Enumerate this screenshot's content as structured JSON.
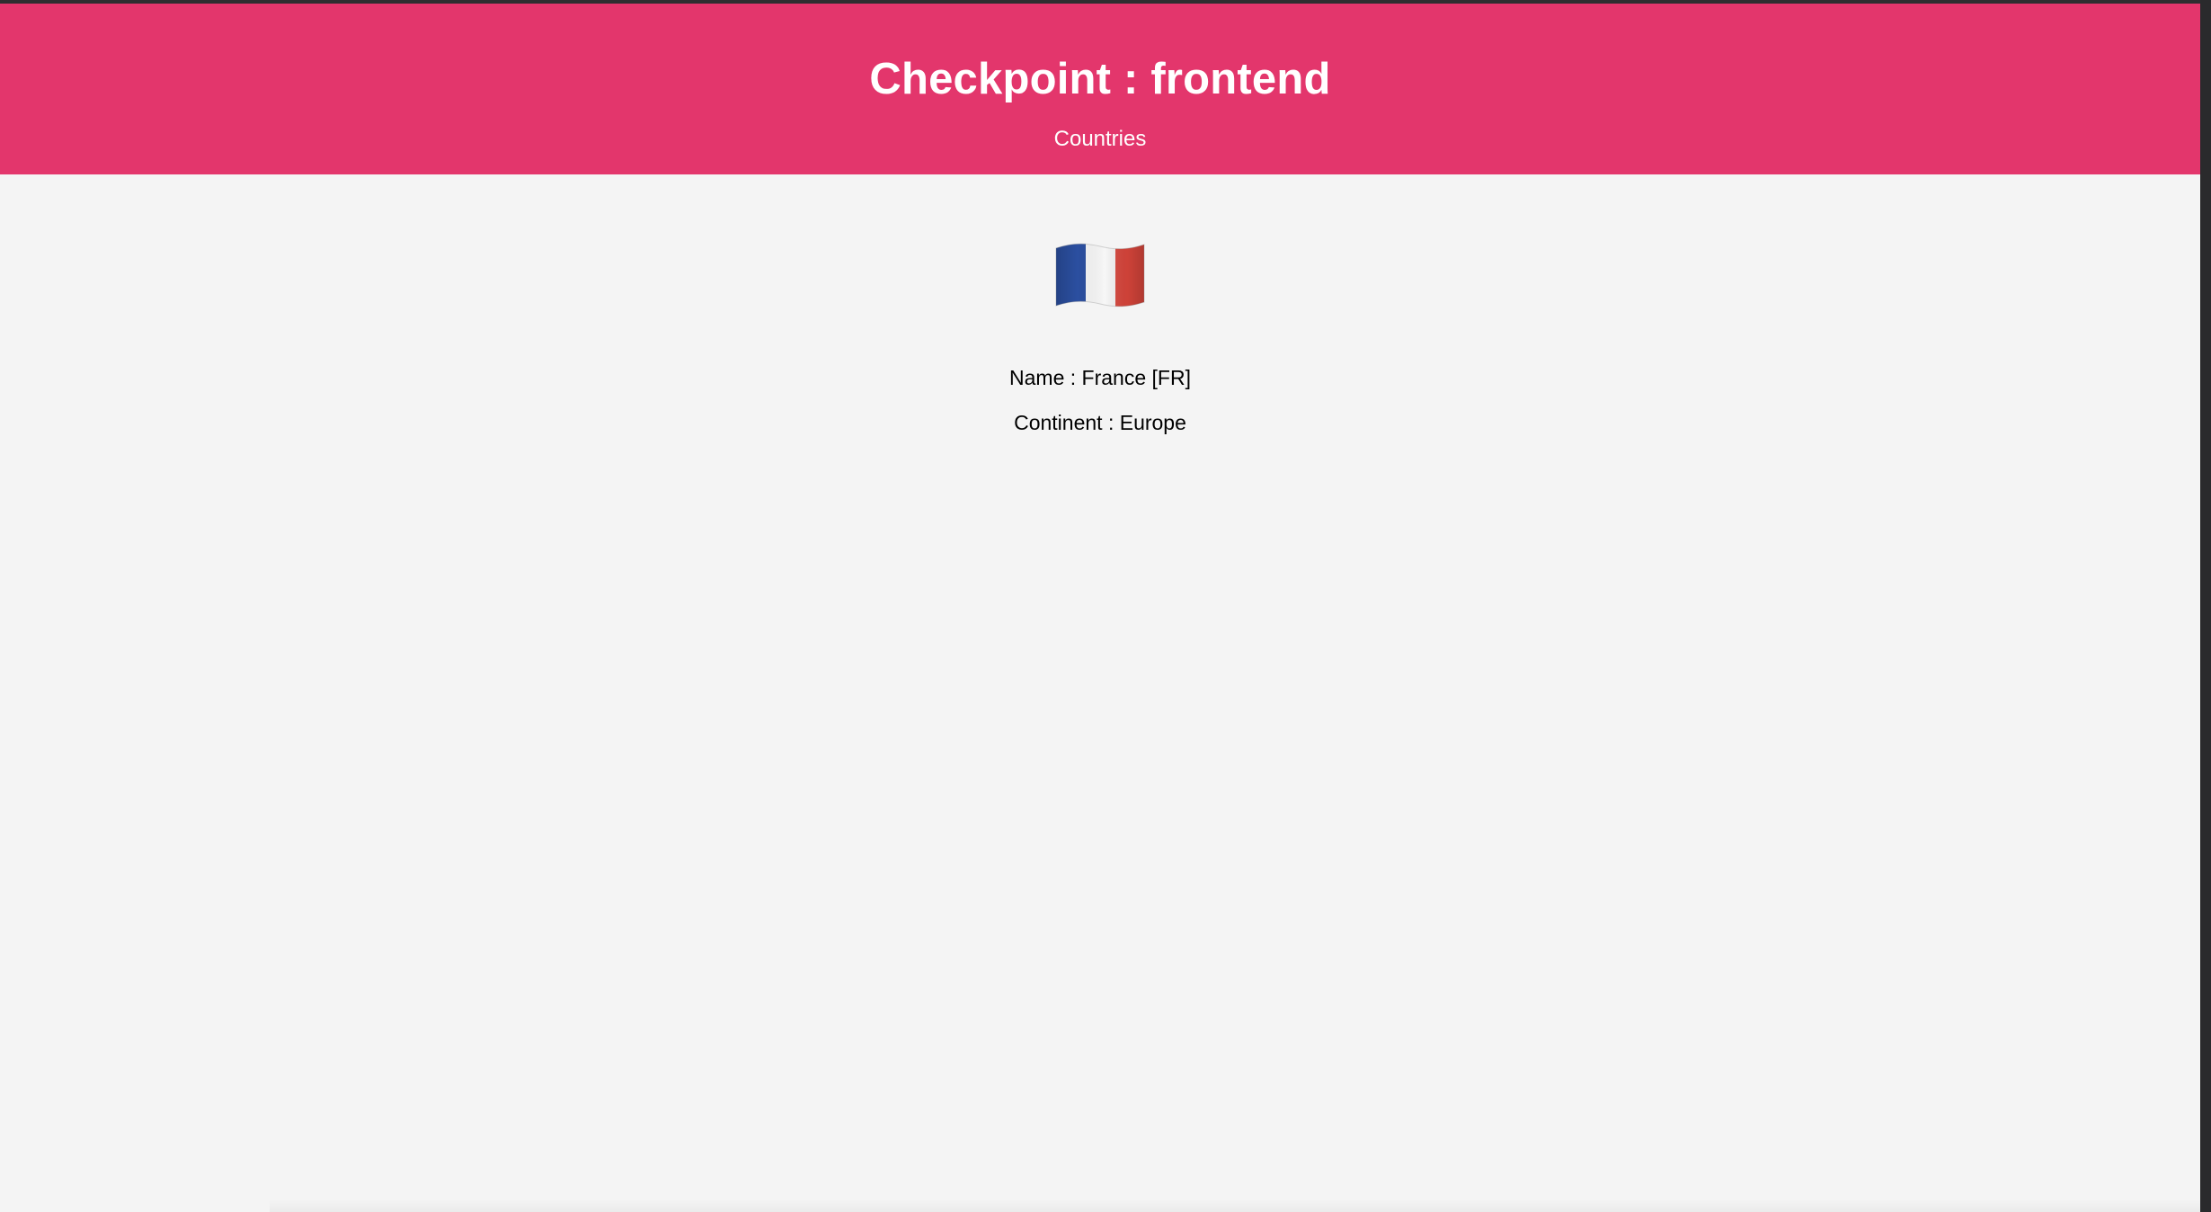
{
  "header": {
    "title": "Checkpoint : frontend",
    "nav_link": "Countries",
    "background_color": "#e3366c"
  },
  "country": {
    "flag_icon": "france-flag-icon",
    "name_line": "Name : France [FR]",
    "continent_line": "Continent : Europe"
  }
}
